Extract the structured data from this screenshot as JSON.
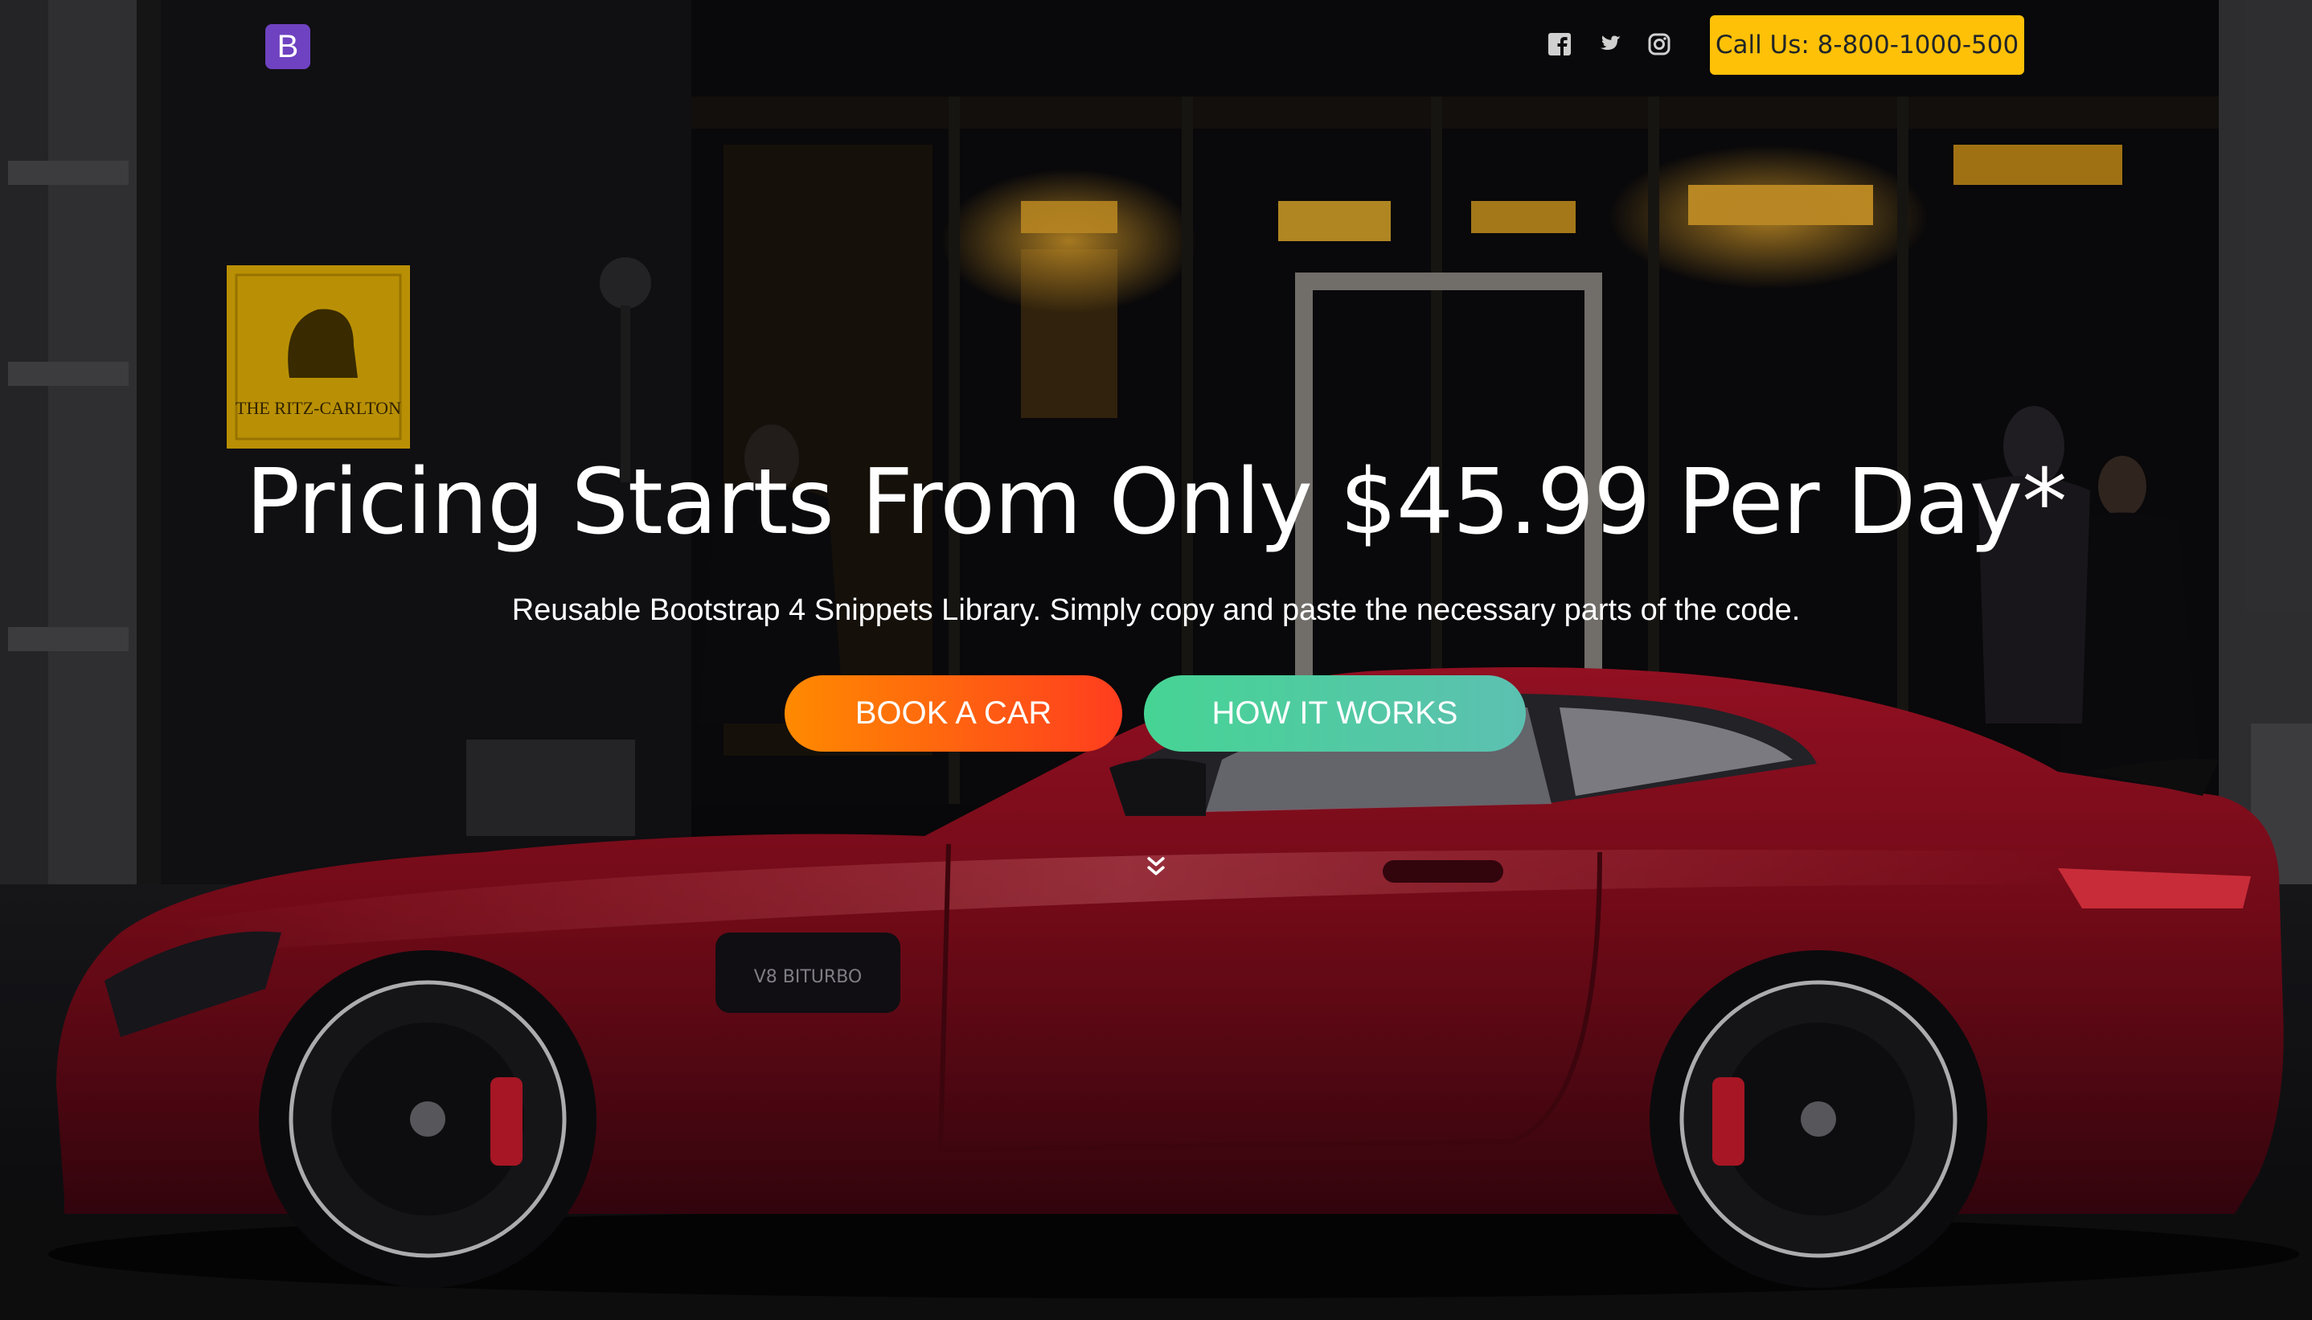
{
  "navbar": {
    "brand_letter": "B",
    "social_icons": [
      "facebook-icon",
      "twitter-icon",
      "instagram-icon"
    ],
    "call_label": "Call Us: 8-800-1000-500"
  },
  "hero": {
    "headline": "Pricing Starts From Only $45.99 Per Day*",
    "subheadline": "Reusable Bootstrap 4 Snippets Library. Simply copy and paste the necessary parts of the code.",
    "book_label": "BOOK A CAR",
    "how_label": "HOW IT WORKS",
    "scroll_icon": "chevron-double-down-icon",
    "sign_text": "THE RITZ-CARLTON",
    "car_badge": "V8 BITURBO"
  },
  "colors": {
    "brand": "#6f42c1",
    "call_button": "#ffc107",
    "book_gradient": [
      "#ff8a00",
      "#ff3d1f"
    ],
    "how_gradient": [
      "#46d494",
      "#5cc0b1"
    ],
    "car": "#8e0f1c"
  }
}
